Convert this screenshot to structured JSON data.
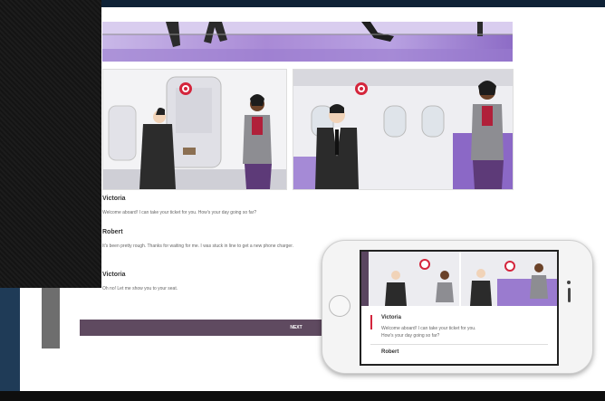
{
  "lesson": {
    "dialogue": [
      {
        "speaker": "Victoria",
        "line": "Welcome aboard! I can take your ticket for you. How's your day going so far?"
      },
      {
        "speaker": "Robert",
        "line": "It's been pretty rough. Thanks for waiting for me. I was stuck in line to get a new phone charger."
      },
      {
        "speaker": "Victoria",
        "line": "Oh no! Let me show you to your seat."
      }
    ],
    "next_label": "NEXT"
  },
  "phone": {
    "speaker": "Victoria",
    "line1": "Welcome aboard! I can take your ticket for you.",
    "line2": "How's your day going so far?",
    "next_speaker": "Robert"
  },
  "colors": {
    "accent": "#d4253c",
    "button": "#5f4a60",
    "banner": "#a98ad6"
  }
}
